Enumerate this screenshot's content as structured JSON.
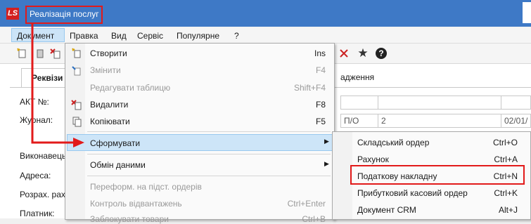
{
  "window": {
    "title": "Реалізація послуг",
    "logo_text": "LS"
  },
  "menubar": [
    "Документ",
    "Правка",
    "Вид",
    "Сервіс",
    "Популярне",
    "?"
  ],
  "toolbar": {
    "icons": [
      "new-icon",
      "pin-icon",
      "delete-icon",
      "copy-icon",
      "cancel-icon",
      "star-icon",
      "help-icon"
    ],
    "star": "★",
    "help": "?"
  },
  "tabs": {
    "rekvizity": "Реквізи",
    "nadhodzhennia": "адження"
  },
  "form": {
    "labels": [
      "АКТ №:",
      "Журнал:",
      "Виконавець",
      "Адреса:",
      "Розрах. рах",
      "Платник:"
    ],
    "cells": [
      "П/О",
      "2",
      "02/01/"
    ]
  },
  "document_menu": [
    {
      "label": "Створити",
      "shortcut": "Ins",
      "disabled": false,
      "icon": "new-icon"
    },
    {
      "label": "Змінити",
      "shortcut": "F4",
      "disabled": true,
      "icon": "edit-icon"
    },
    {
      "label": "Редагувати таблицю",
      "shortcut": "Shift+F4",
      "disabled": true
    },
    {
      "label": "Видалити",
      "shortcut": "F8",
      "disabled": false,
      "icon": "delete-icon"
    },
    {
      "label": "Копіювати",
      "shortcut": "F5",
      "disabled": false,
      "icon": "copy-icon"
    },
    {
      "label": "Сформувати",
      "shortcut": "",
      "disabled": false,
      "highlighted": true,
      "submenu": true
    },
    {
      "label": "Обмін даними",
      "shortcut": "",
      "disabled": false,
      "submenu": true
    },
    {
      "label": "Переформ. на підст. ордерів",
      "shortcut": "",
      "disabled": true
    },
    {
      "label": "Контроль відвантажень",
      "shortcut": "Ctrl+Enter",
      "disabled": true
    },
    {
      "label": "Заблокувати товари",
      "shortcut": "Ctrl+B",
      "disabled": true
    }
  ],
  "submenu": [
    {
      "label": "Складський ордер",
      "shortcut": "Ctrl+O"
    },
    {
      "label": "Рахунок",
      "shortcut": "Ctrl+A"
    },
    {
      "label": "Податкову накладну",
      "shortcut": "Ctrl+N",
      "highlighted": true
    },
    {
      "label": "Прибутковий касовий ордер",
      "shortcut": "Ctrl+K"
    },
    {
      "label": "Документ CRM",
      "shortcut": "Alt+J"
    }
  ],
  "colors": {
    "title_bar": "#3e79c6",
    "annotation": "#e21a1a",
    "highlight": "#cde5f8"
  }
}
